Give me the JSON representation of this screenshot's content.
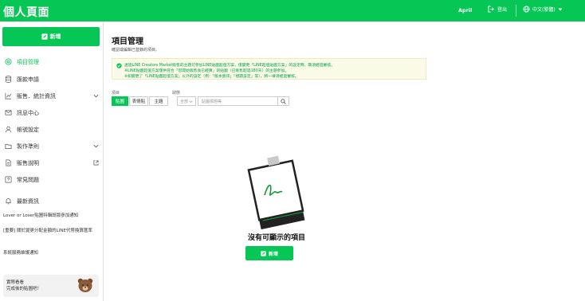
{
  "header": {
    "title": "個人頁面",
    "user": "April",
    "logout_label": "登出",
    "language_label": "中文(繁體)",
    "accent_color": "#06c755"
  },
  "sidebar": {
    "new_label": "新增",
    "items": [
      {
        "label": "項目管理",
        "icon": "target-icon",
        "active": true
      },
      {
        "label": "匯款申請",
        "icon": "database-icon"
      },
      {
        "label": "販售．統計資訊",
        "icon": "chart-icon",
        "expandable": true
      },
      {
        "label": "訊息中心",
        "icon": "mail-icon"
      },
      {
        "label": "帳號設定",
        "icon": "user-icon"
      },
      {
        "label": "製作準則",
        "icon": "folder-icon",
        "expandable": true
      },
      {
        "label": "販售說明",
        "icon": "document-icon",
        "external": true
      },
      {
        "label": "常見問題",
        "icon": "question-icon"
      },
      {
        "label": "最新資訊",
        "icon": "bell-icon"
      }
    ],
    "notices": [
      "Lover or Loser貼圖特輯既版參加通知",
      "[重要] 關於變更分配金額的LINE代幣換算匯率",
      "系統服務維護通知"
    ],
    "promo": {
      "line1": "實際看看",
      "line2": "完成後的貼圖吧！",
      "icon": "bear-icon"
    }
  },
  "main": {
    "title": "項目管理",
    "subtitle": "確認或編輯已登錄的項目。",
    "alert_lines": [
      "透過LINE Creators Market販售的主題可參加LINE貼圖超值方案，僅變更「LINE超值貼圖方案」的設定時，無須經過審核。",
      "※LINE貼圖超值方案僅供符合「您開始販售後已經算」的貼圖（已販售超過180天）的主題參加。",
      "※如變更了「LINE貼圖超值方案」以外的設定（例：「版本資訊」「標題設定」等），將一律須經過審核。"
    ],
    "filters": {
      "type_label": "項目",
      "types": [
        "貼圖",
        "表情貼",
        "主題"
      ],
      "active_type": "貼圖",
      "status_label": "狀態",
      "status_value": "全部",
      "search_placeholder": "貼圖標題等"
    },
    "empty_state": {
      "message": "沒有可顯示的項目",
      "button_label": "新增"
    }
  }
}
